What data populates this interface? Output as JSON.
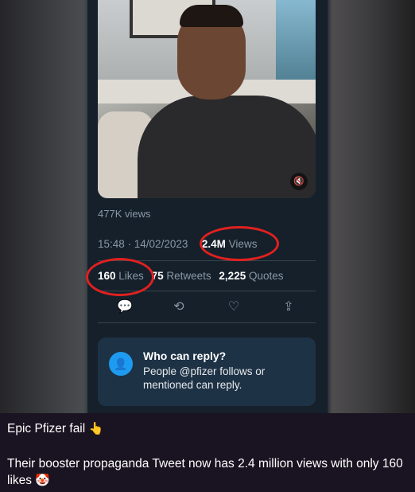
{
  "tweet": {
    "video_views": "477K views",
    "timestamp": "15:48 · 14/02/2023",
    "views_count": "2.4M",
    "views_label": "Views",
    "likes_count": "160",
    "likes_label": "Likes",
    "retweets_count": "75",
    "retweets_label": "Retweets",
    "quotes_count": "2,225",
    "quotes_label": "Quotes",
    "mute_icon": "🔇",
    "actions": {
      "reply_icon": "💬",
      "retweet_icon": "⟲",
      "like_icon": "♡",
      "share_icon": "⇪"
    },
    "reply_box": {
      "title": "Who can reply?",
      "text": "People @pfizer follows or mentioned can reply.",
      "icon": "👤"
    }
  },
  "annotation_color": "#e0211f",
  "caption": {
    "line1": "Epic Pfizer fail",
    "line1_emoji": "👆",
    "line2": "Their booster propaganda Tweet now has 2.4 million views with only 160 likes",
    "line2_emoji": "🤡"
  }
}
